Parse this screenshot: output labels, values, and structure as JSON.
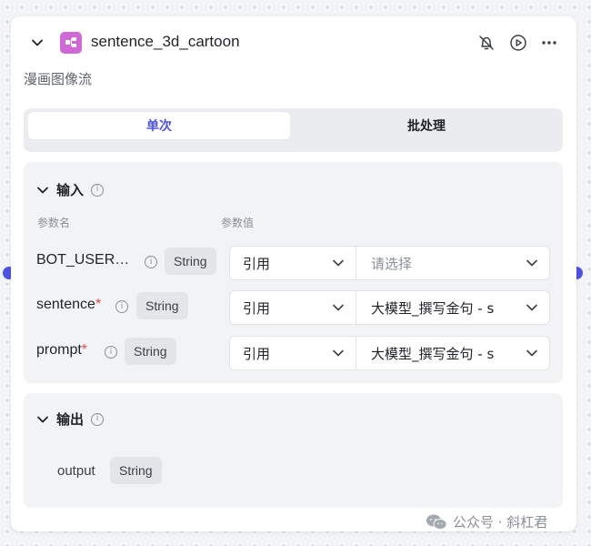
{
  "node": {
    "title": "sentence_3d_cartoon",
    "subtitle": "漫画图像流",
    "header_icons": [
      "bell-off-icon",
      "play-circle-icon",
      "more-icon"
    ],
    "icon_color": "#d068d6"
  },
  "mode_tabs": {
    "single": "单次",
    "batch": "批处理",
    "active": "single"
  },
  "input_section": {
    "title": "输入",
    "col_name": "参数名",
    "col_value": "参数值",
    "params": [
      {
        "name": "BOT_USER…",
        "required": "",
        "type": "String",
        "ref": "引用",
        "value": "请选择",
        "placeholder": true
      },
      {
        "name": "sentence",
        "required": "*",
        "type": "String",
        "ref": "引用",
        "value": "大模型_撰写金句 - s",
        "placeholder": false
      },
      {
        "name": "prompt",
        "required": "*",
        "type": "String",
        "ref": "引用",
        "value": "大模型_撰写金句 - s",
        "placeholder": false
      }
    ]
  },
  "output_section": {
    "title": "输出",
    "outputs": [
      {
        "name": "output",
        "type": "String"
      }
    ]
  },
  "watermark": {
    "text": "公众号 · 斜杠君",
    "icon": "wechat-icon"
  },
  "colors": {
    "accent": "#4d53e8",
    "required": "#e5484d",
    "port": "#4d53e8"
  }
}
